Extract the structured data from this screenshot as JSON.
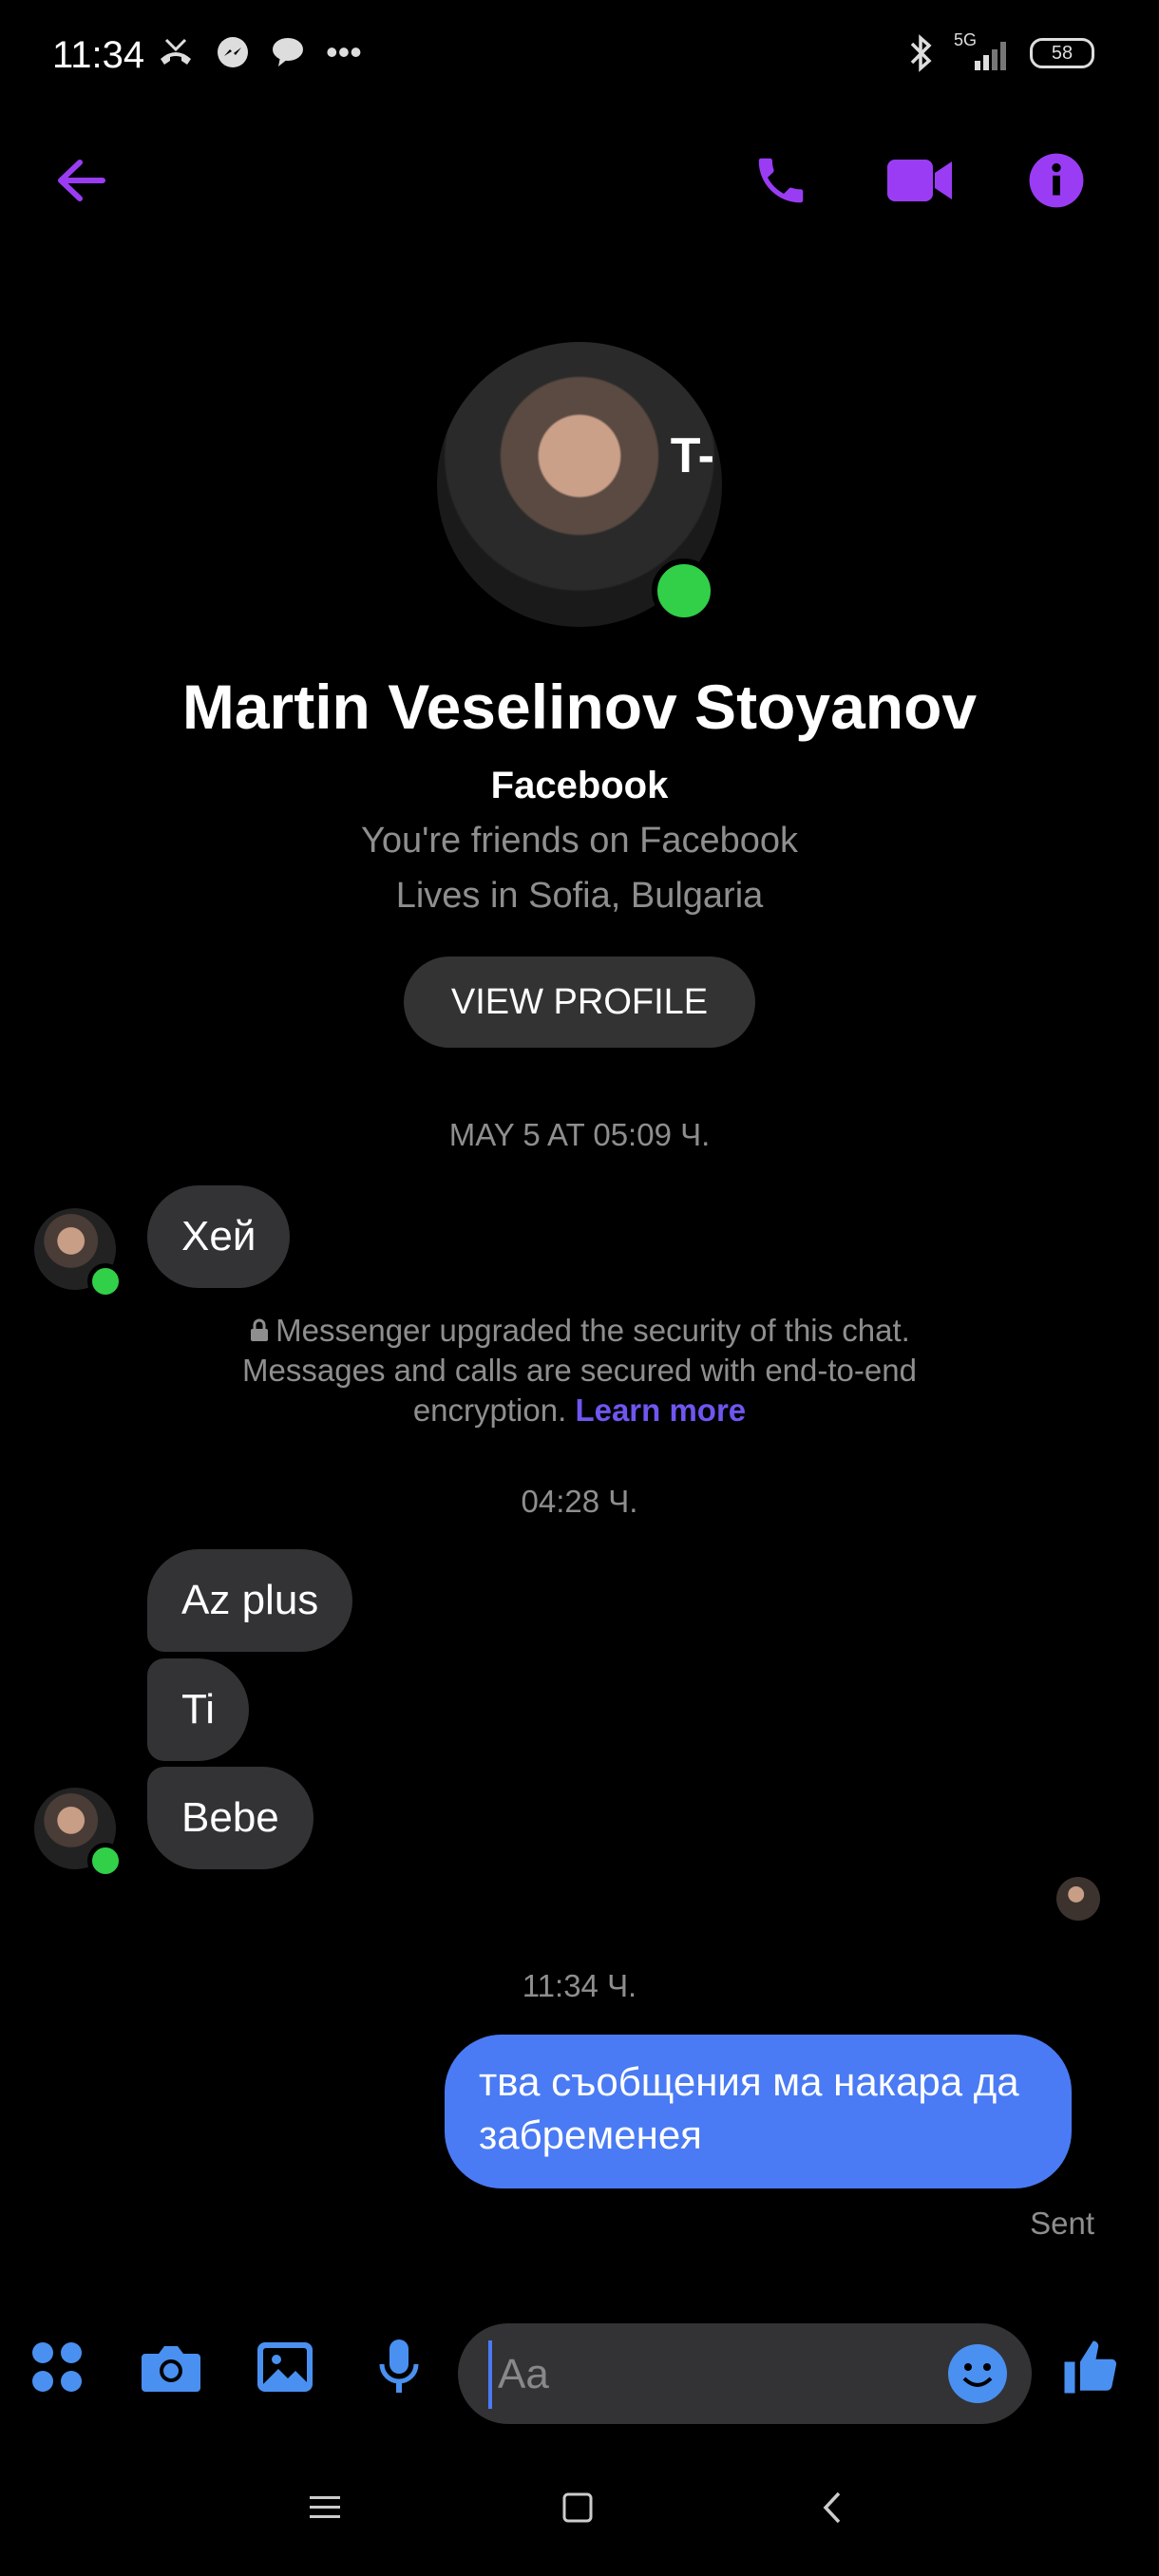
{
  "status_bar": {
    "time": "11:34",
    "network": "5G",
    "battery": "58"
  },
  "profile": {
    "name": "Martin Veselinov Stoyanov",
    "platform": "Facebook",
    "friends_text": "You're friends on Facebook",
    "location_text": "Lives in Sofia, Bulgaria",
    "view_profile_label": "VIEW PROFILE"
  },
  "chat": {
    "timestamp_1": "MAY 5 AT 05:09 Ч.",
    "message_1": "Хей",
    "security_text": "Messenger upgraded the security of this chat. Messages and calls are secured with end-to-end encryption.",
    "learn_more": "Learn more",
    "timestamp_2": "04:28 Ч.",
    "message_2": "Az plus",
    "message_3": "Ti",
    "message_4": "Bebe",
    "timestamp_3": "11:34 Ч.",
    "outgoing_message": "тва съобщения ма накара да забременея",
    "sent_label": "Sent"
  },
  "composer": {
    "placeholder": "Aa"
  },
  "colors": {
    "accent_purple": "#9b3cf5",
    "accent_blue": "#4a90f0",
    "bubble_out": "#4a7bf4"
  }
}
